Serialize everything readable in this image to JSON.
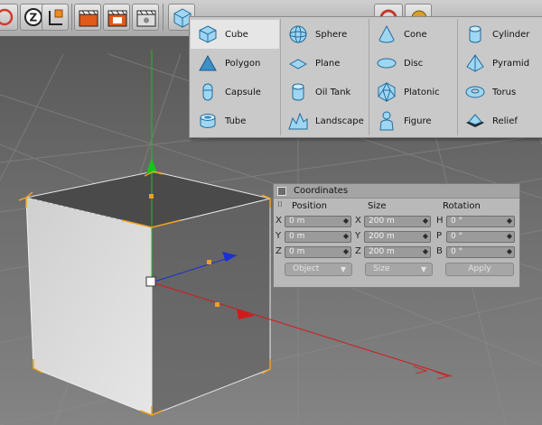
{
  "primitives_menu": {
    "columns": [
      [
        {
          "label": "Cube",
          "icon": "cube-icon",
          "selected": true
        },
        {
          "label": "Polygon",
          "icon": "polygon-icon"
        },
        {
          "label": "Capsule",
          "icon": "capsule-icon"
        },
        {
          "label": "Tube",
          "icon": "tube-icon"
        }
      ],
      [
        {
          "label": "Sphere",
          "icon": "sphere-icon"
        },
        {
          "label": "Plane",
          "icon": "plane-icon"
        },
        {
          "label": "Oil Tank",
          "icon": "oil-tank-icon"
        },
        {
          "label": "Landscape",
          "icon": "landscape-icon"
        }
      ],
      [
        {
          "label": "Cone",
          "icon": "cone-icon"
        },
        {
          "label": "Disc",
          "icon": "disc-icon"
        },
        {
          "label": "Platonic",
          "icon": "platonic-icon"
        },
        {
          "label": "Figure",
          "icon": "figure-icon"
        }
      ],
      [
        {
          "label": "Cylinder",
          "icon": "cylinder-icon"
        },
        {
          "label": "Pyramid",
          "icon": "pyramid-icon"
        },
        {
          "label": "Torus",
          "icon": "torus-icon"
        },
        {
          "label": "Relief",
          "icon": "relief-icon"
        }
      ]
    ]
  },
  "coordinates": {
    "title": "Coordinates",
    "headers": {
      "position": "Position",
      "size": "Size",
      "rotation": "Rotation"
    },
    "rows": [
      {
        "pos_axis": "X",
        "pos": "0 m",
        "size_axis": "X",
        "size": "200 m",
        "rot_axis": "H",
        "rot": "0 °"
      },
      {
        "pos_axis": "Y",
        "pos": "0 m",
        "size_axis": "Y",
        "size": "200 m",
        "rot_axis": "P",
        "rot": "0 °"
      },
      {
        "pos_axis": "Z",
        "pos": "0 m",
        "size_axis": "Z",
        "size": "200 m",
        "rot_axis": "B",
        "rot": "0 °"
      }
    ],
    "mode_dropdown": "Object",
    "size_dropdown": "Size",
    "apply_label": "Apply"
  },
  "colors": {
    "accent_blue": "#3d8fc4",
    "icon_light": "#9fd6f2",
    "axis_x": "#d11b1b",
    "axis_y": "#16c41a",
    "axis_z": "#1a2fd6",
    "selection_orange": "#f0a020"
  }
}
